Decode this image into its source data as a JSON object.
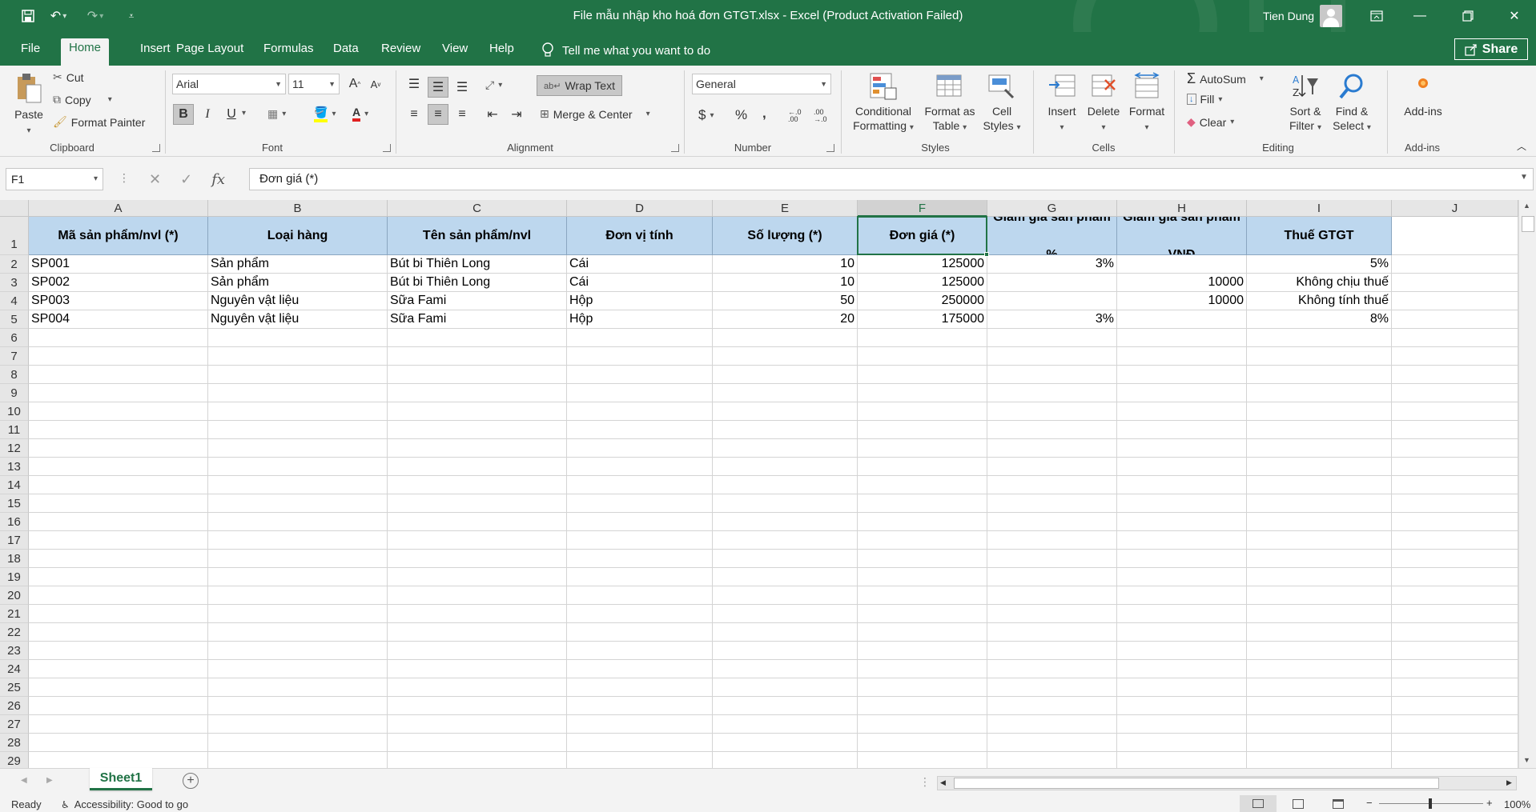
{
  "titlebar": {
    "title": "File mẫu nhập kho hoá đơn GTGT.xlsx  -  Excel (Product Activation Failed)",
    "user_name": "Tien Dung"
  },
  "tabs": [
    "File",
    "Home",
    "Insert",
    "Page Layout",
    "Formulas",
    "Data",
    "Review",
    "View",
    "Help"
  ],
  "active_tab": "Home",
  "tell_me": "Tell me what you want to do",
  "share_label": "Share",
  "ribbon": {
    "clipboard": {
      "paste": "Paste",
      "cut": "Cut",
      "copy": "Copy",
      "format_painter": "Format Painter",
      "label": "Clipboard"
    },
    "font": {
      "name": "Arial",
      "size": "11",
      "bold": "B",
      "italic": "I",
      "underline": "U",
      "label": "Font"
    },
    "alignment": {
      "wrap_text": "Wrap Text",
      "merge_center": "Merge & Center",
      "label": "Alignment"
    },
    "number": {
      "format": "General",
      "currency": "$",
      "percent": "%",
      "comma": ",",
      "label": "Number"
    },
    "styles": {
      "conditional": "Conditional",
      "conditional2": "Formatting",
      "format_table": "Format as",
      "format_table2": "Table",
      "cell_styles": "Cell",
      "cell_styles2": "Styles",
      "label": "Styles"
    },
    "cells": {
      "insert": "Insert",
      "delete": "Delete",
      "format": "Format",
      "label": "Cells"
    },
    "editing": {
      "autosum": "AutoSum",
      "fill": "Fill",
      "clear": "Clear",
      "sort": "Sort &",
      "sort2": "Filter",
      "find": "Find &",
      "find2": "Select",
      "label": "Editing"
    },
    "addins": {
      "addins": "Add-ins",
      "label": "Add-ins"
    }
  },
  "formula_bar": {
    "name_box": "F1",
    "formula": "Đơn giá (*)",
    "fx": "fx"
  },
  "columns": [
    "A",
    "B",
    "C",
    "D",
    "E",
    "F",
    "G",
    "H",
    "I",
    "J"
  ],
  "selected_column": "F",
  "rows": [
    "1",
    "2",
    "3",
    "4",
    "5",
    "6",
    "7",
    "8",
    "9",
    "10",
    "11",
    "12",
    "13",
    "14",
    "15",
    "16",
    "17",
    "18",
    "19",
    "20",
    "21",
    "22",
    "23",
    "24",
    "25",
    "26",
    "27",
    "28",
    "29"
  ],
  "header_row": [
    "Mã sản phẩm/nvl (*)",
    "Loại hàng",
    "Tên sản phẩm/nvl",
    "Đơn vị tính",
    "Số lượng (*)",
    "Đơn giá (*)",
    "Giảm giá sản phẩm %",
    "Giảm giá sản phẩm VNĐ",
    "Thuế GTGT"
  ],
  "data_rows": [
    [
      "SP001",
      "Sản phẩm",
      "Bút bi Thiên Long",
      "Cái",
      "10",
      "125000",
      "3%",
      "",
      "5%"
    ],
    [
      "SP002",
      "Sản phẩm",
      "Bút bi Thiên Long",
      "Cái",
      "10",
      "125000",
      "",
      "10000",
      "Không chịu thuế"
    ],
    [
      "SP003",
      "Nguyên vật liệu",
      "Sữa Fami",
      "Hộp",
      "50",
      "250000",
      "",
      "10000",
      "Không tính thuế"
    ],
    [
      "SP004",
      "Nguyên vật liệu",
      "Sữa Fami",
      "Hộp",
      "20",
      "175000",
      "3%",
      "",
      "8%"
    ]
  ],
  "sheet_tab": "Sheet1",
  "status": {
    "ready": "Ready",
    "accessibility": "Accessibility: Good to go",
    "zoom": "100%"
  },
  "colors": {
    "brand": "#217346",
    "header_fill": "#bdd7ee"
  }
}
